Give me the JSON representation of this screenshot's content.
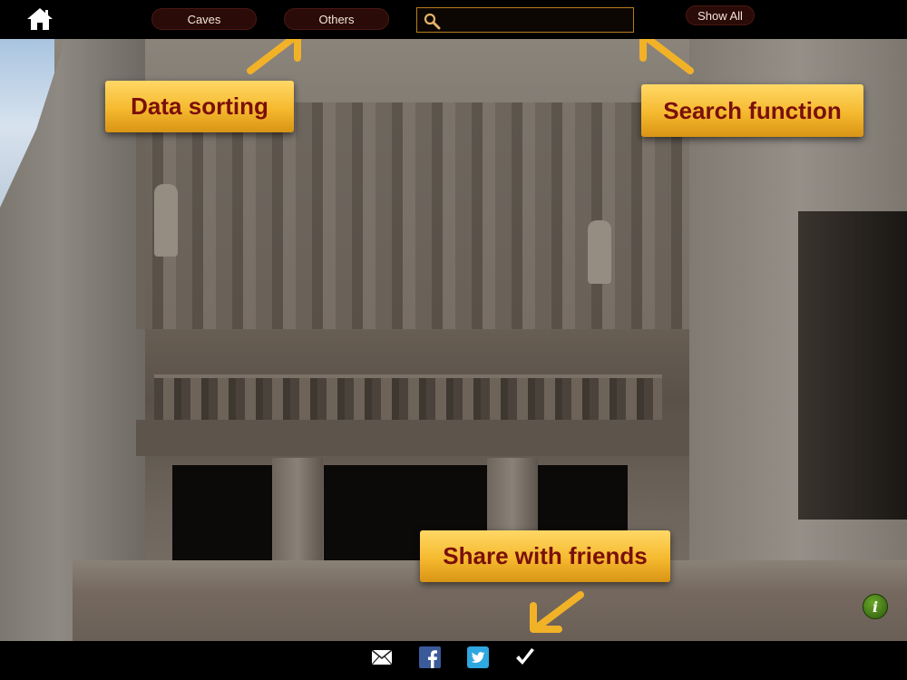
{
  "toolbar": {
    "home_icon": "home-icon",
    "caves_label": "Caves",
    "others_label": "Others",
    "search_placeholder": "",
    "search_value": "",
    "show_all_label": "Show All"
  },
  "annotations": {
    "sorting": "Data sorting",
    "search": "Search function",
    "share": "Share with friends"
  },
  "bottom_bar": {
    "icons": [
      "mail-icon",
      "facebook-icon",
      "twitter-icon",
      "checkmark-icon"
    ]
  },
  "colors": {
    "callout_top": "#ffd866",
    "callout_bottom": "#d99415",
    "callout_text": "#7a0f0a",
    "pill_bg": "#2a0b08",
    "search_border": "#b77c1f",
    "info_green": "#3f7a14"
  }
}
